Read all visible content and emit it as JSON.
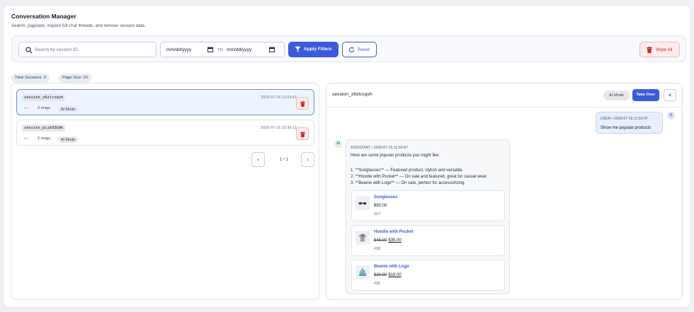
{
  "header": {
    "title": "Conversation Manager",
    "subtitle": "Search, paginate, inspect full chat threads, and remove session data."
  },
  "filters": {
    "search_placeholder": "Search by session ID...",
    "date_from_placeholder": "mm/dd/yyyy",
    "date_to_label": "TO",
    "date_to_placeholder": "mm/dd/yyyy",
    "apply_label": "Apply Filters",
    "reset_label": "Reset",
    "wipe_label": "Wipe All"
  },
  "stats": {
    "total_sessions": "Total Sessions: 2",
    "page_size": "Page Size: 25"
  },
  "sessions": [
    {
      "id": "session_z6zlcsqvh",
      "date": "2026-07-16 11:53:47",
      "dash": "—",
      "msgs": "2 msgs",
      "mode": "AI Mode",
      "selected": true
    },
    {
      "id": "session_piik03b9k",
      "date": "2026-07-16 10:39:12",
      "dash": "—",
      "msgs": "2 msgs",
      "mode": "AI Mode",
      "selected": false
    }
  ],
  "pagination": {
    "prev": "‹",
    "label": "1 / 1",
    "next": "›"
  },
  "detail": {
    "session_id": "session_z6zlcsqvh",
    "mode_badge": "AI Mode",
    "take_over_label": "Take Over",
    "close_label": "×",
    "user_avatar": "U",
    "ai_avatar": "AI",
    "user_message": {
      "header": "USER • 2026-07-16 11:53:47",
      "text": "Show me popular products"
    },
    "assistant_message": {
      "header": "ASSISTANT • 2026-07-16 11:53:47",
      "lines": [
        "Here are some popular products you might like:",
        "1. **Sunglasses** — Featured product, stylish and versatile.",
        "2. **Hoodie with Pocket** — On sale and featured, great for casual wear.",
        "3. **Beanie with Logo** — On sale, perfect for accessorizing."
      ]
    },
    "products": [
      {
        "name": "Sunglasses",
        "price": "$90.00",
        "old_price": "",
        "new_price": "",
        "id": "#17",
        "icon": "sunglasses-icon"
      },
      {
        "name": "Hoodie with Pocket",
        "price": "",
        "old_price": "$45.00",
        "new_price": "$35.00",
        "id": "#18",
        "icon": "hoodie-icon"
      },
      {
        "name": "Beanie with Logo",
        "price": "",
        "old_price": "$20.00",
        "new_price": "$18.00",
        "id": "#31",
        "icon": "beanie-icon"
      }
    ]
  },
  "colors": {
    "primary": "#3b5bdb",
    "danger": "#c92a2a",
    "selected_bg": "#eef4ff"
  }
}
